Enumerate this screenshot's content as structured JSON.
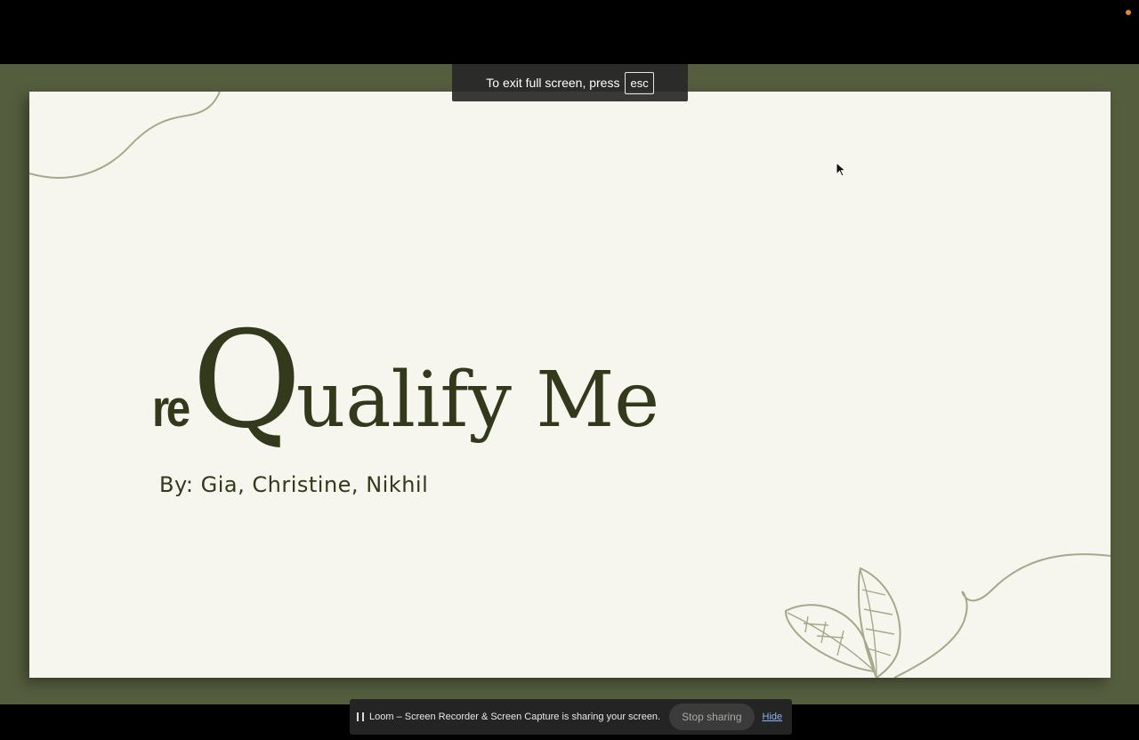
{
  "slide": {
    "title_prefix": "re",
    "title_q": "Q",
    "title_rest": "ualify Me",
    "authors": "By: Gia, Christine, Nikhil"
  },
  "fullscreen_toast": {
    "message": "To exit full screen, press",
    "key": "esc"
  },
  "share_bar": {
    "message": "Loom – Screen Recorder & Screen Capture is sharing your screen.",
    "stop_label": "Stop sharing",
    "hide_label": "Hide"
  },
  "colors": {
    "stage": "#545e3e",
    "slide": "#f6f6ef",
    "title_text": "#323a1b",
    "decoration": "#a7a88a",
    "recording_dot": "#e8872c"
  },
  "icons": {
    "cursor": "arrow-cursor-icon",
    "pause": "pause-icon",
    "recording": "recording-indicator-icon"
  }
}
